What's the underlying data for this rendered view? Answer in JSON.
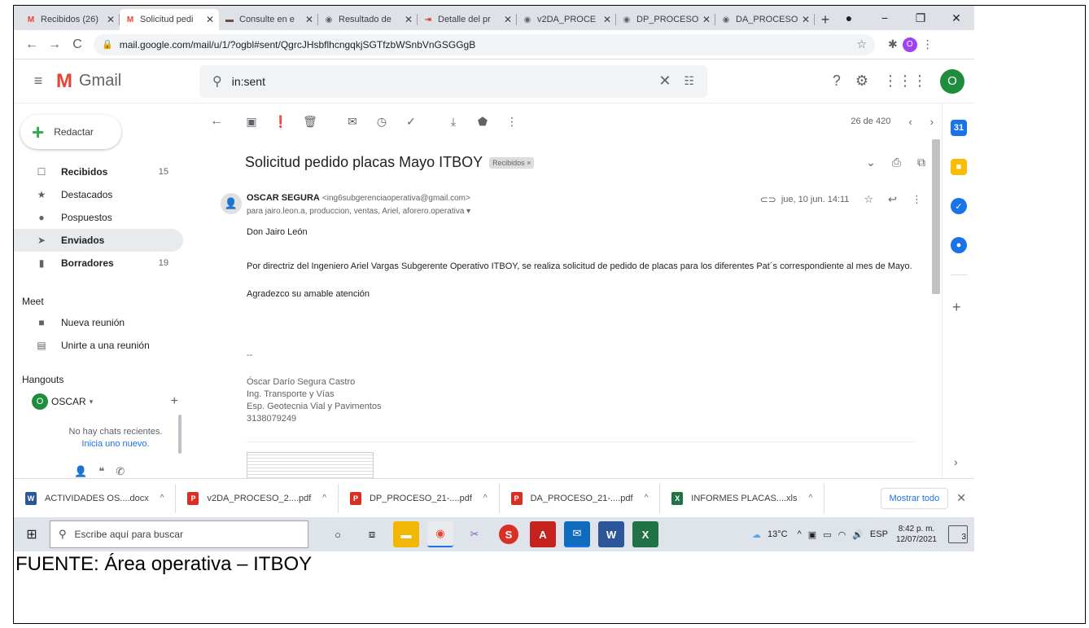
{
  "browser": {
    "tabs": [
      {
        "title": "Recibidos (26)",
        "favicon": "gmail-icon",
        "active": false
      },
      {
        "title": "Solicitud pedi",
        "favicon": "gmail-icon",
        "active": true
      },
      {
        "title": "Consulte en e",
        "favicon": "site-icon",
        "active": false
      },
      {
        "title": "Resultado de",
        "favicon": "globe-icon",
        "active": false
      },
      {
        "title": "Detalle del pr",
        "favicon": "login-icon",
        "active": false
      },
      {
        "title": "v2DA_PROCE",
        "favicon": "globe-icon",
        "active": false
      },
      {
        "title": "DP_PROCESO",
        "favicon": "globe-icon",
        "active": false
      },
      {
        "title": "DA_PROCESO",
        "favicon": "globe-icon",
        "active": false
      }
    ],
    "new_tab": "+",
    "url": "mail.google.com/mail/u/1/?ogbl#sent/QgrcJHsbflhcngqkjSGTfzbWSnbVnGSGGgB",
    "profile_initial": "O"
  },
  "gmail": {
    "logo_text": "Gmail",
    "search_value": "in:sent",
    "account_initial": "O",
    "compose_label": "Redactar",
    "nav": [
      {
        "label": "Recibidos",
        "count": "15",
        "bold": true,
        "selected": false,
        "icon": "inbox-icon",
        "glyph": "☐"
      },
      {
        "label": "Destacados",
        "count": "",
        "bold": false,
        "selected": false,
        "icon": "star-icon",
        "glyph": "★"
      },
      {
        "label": "Pospuestos",
        "count": "",
        "bold": false,
        "selected": false,
        "icon": "clock-icon",
        "glyph": "●"
      },
      {
        "label": "Enviados",
        "count": "",
        "bold": true,
        "selected": true,
        "icon": "send-icon",
        "glyph": "➤"
      },
      {
        "label": "Borradores",
        "count": "19",
        "bold": true,
        "selected": false,
        "icon": "draft-icon",
        "glyph": "▮"
      }
    ],
    "meet": {
      "title": "Meet",
      "new_meeting": "Nueva reunión",
      "join_meeting": "Unirte a una reunión"
    },
    "hangouts": {
      "title": "Hangouts",
      "user": "OSCAR",
      "user_initial": "O",
      "no_chats": "No hay chats recientes.",
      "start_new": "Inicia uno nuevo."
    },
    "pager": "26 de 420",
    "message": {
      "subject": "Solicitud pedido placas Mayo ITBOY",
      "label": "Recibidos ×",
      "sender_name": "OSCAR SEGURA",
      "sender_email": "<ing6subgerenciaoperativa@gmail.com>",
      "recipients": "para jairo.leon.a, produccion, ventas, Ariel, aforero.operativa ▾",
      "date": "jue, 10 jun. 14:11",
      "greeting": "Don Jairo León",
      "body_1": "Por directriz del Ingeniero Ariel Vargas Subgerente Operativo ITBOY, se realiza solicitud de  pedido de placas para los diferentes Pat´s correspondiente al mes de Mayo.",
      "body_2": "Agradezco su amable atención",
      "sig_dash": "--",
      "sig_name": "Óscar Darío Segura Castro",
      "sig_line2": "Ing. Transporte y Vías",
      "sig_line3": "Esp. Geotecnia Vial y Pavimentos",
      "sig_phone": "3138079249"
    }
  },
  "downloads": {
    "items": [
      {
        "name": "ACTIVIDADES OS....docx",
        "type": "word",
        "color": "#2b579a",
        "glyph": "W"
      },
      {
        "name": "v2DA_PROCESO_2....pdf",
        "type": "pdf",
        "color": "#d93025",
        "glyph": "P"
      },
      {
        "name": "DP_PROCESO_21-....pdf",
        "type": "pdf",
        "color": "#d93025",
        "glyph": "P"
      },
      {
        "name": "DA_PROCESO_21-....pdf",
        "type": "pdf",
        "color": "#d93025",
        "glyph": "P"
      },
      {
        "name": "INFORMES PLACAS....xls",
        "type": "excel",
        "color": "#217346",
        "glyph": "X"
      }
    ],
    "show_all": "Mostrar todo"
  },
  "taskbar": {
    "search_placeholder": "Escribe aquí para buscar",
    "temperature": "13°C",
    "language": "ESP",
    "time": "8:42 p. m.",
    "date": "12/07/2021",
    "notifications": "3"
  },
  "caption": "FUENTE: Área operativa – ITBOY"
}
